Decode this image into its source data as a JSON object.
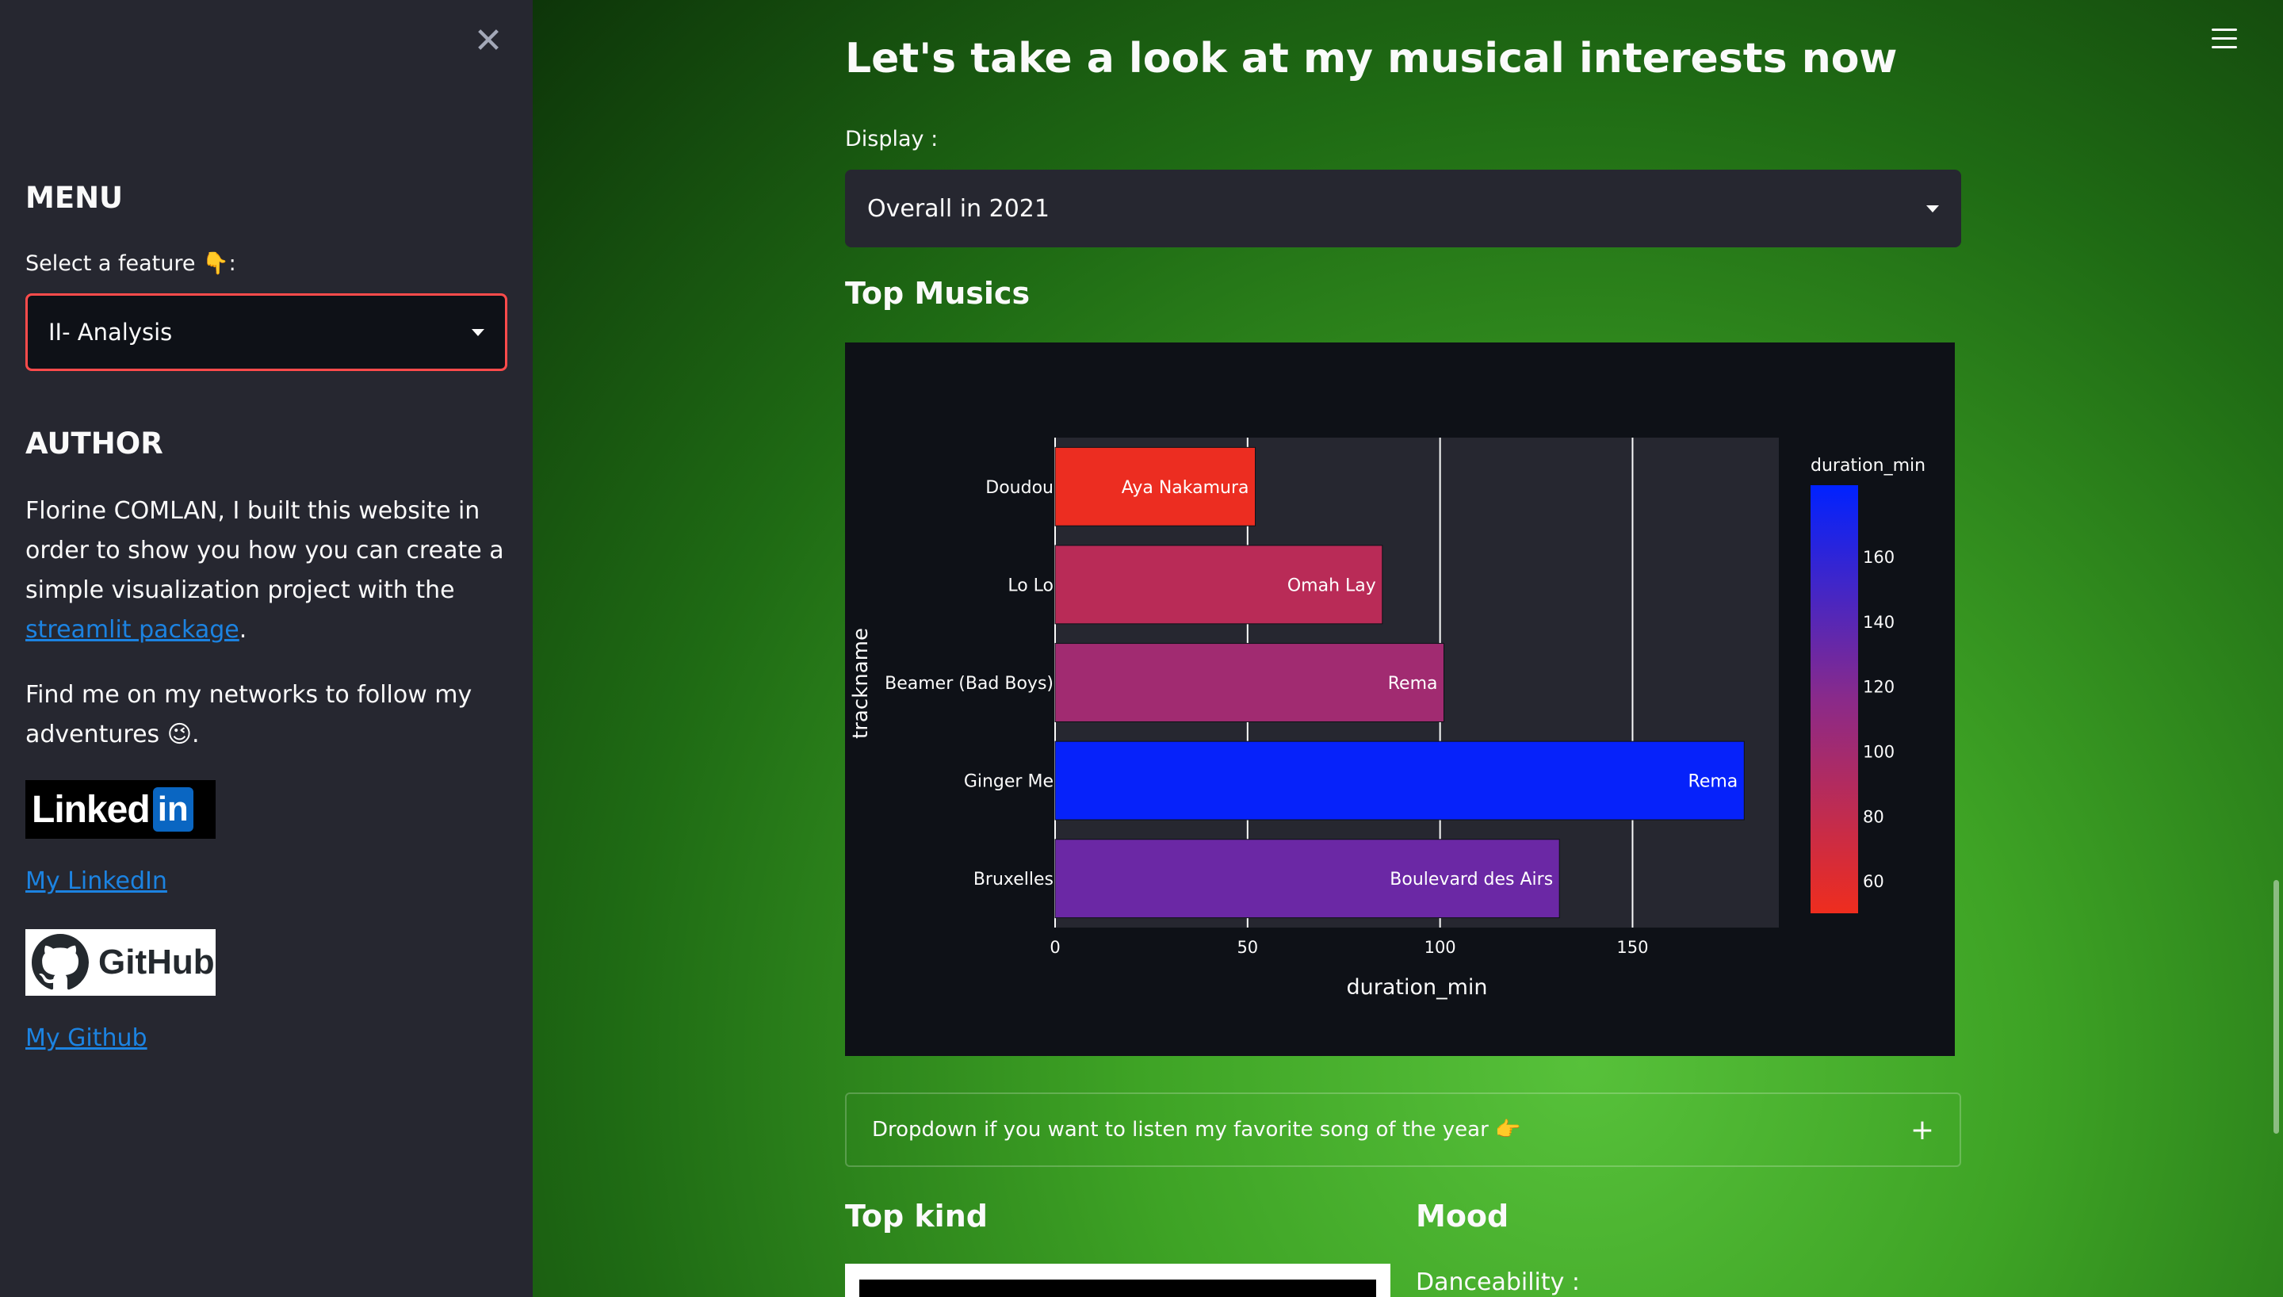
{
  "sidebar": {
    "close_symbol": "✕",
    "menu_title": "MENU",
    "select_label": "Select a feature 👇:",
    "select_value": "II- Analysis",
    "author_title": "AUTHOR",
    "author_text_pre": "Florine COMLAN, I built this website in order to show you how you can create a simple visualization project with the ",
    "author_link": "streamlit package",
    "author_text_post": ".",
    "networks_text": "Find me on my networks to follow my adventures 😉.",
    "linkedin_badge_word": "Linked",
    "linkedin_badge_in": "in",
    "linkedin_link": "My LinkedIn",
    "github_badge_text": "GitHub",
    "github_link": "My Github"
  },
  "main": {
    "title": "Let's take a look at my musical interests now",
    "display_label": "Display :",
    "display_value": "Overall in 2021",
    "top_musics_title": "Top Musics",
    "expander_text": "Dropdown if you want to listen my favorite song of the year 👉",
    "expander_symbol": "+",
    "top_kind_title": "Top kind",
    "mood_title": "Mood",
    "danceability_label": "Danceability :"
  },
  "chart_data": {
    "type": "bar",
    "orientation": "horizontal",
    "categories": [
      "Doudou",
      "Lo Lo",
      "Beamer (Bad Boys)",
      "Ginger Me",
      "Bruxelles"
    ],
    "values": [
      52,
      85,
      101,
      179,
      131
    ],
    "bar_labels": [
      "Aya Nakamura",
      "Omah Lay",
      "Rema",
      "Rema",
      "Boulevard des Airs"
    ],
    "xlabel": "duration_min",
    "ylabel": "trackname",
    "xlim": [
      0,
      188
    ],
    "xticks": [
      "0",
      "50",
      "100",
      "150"
    ],
    "colorbar": {
      "title": "duration_min",
      "range": [
        50,
        182
      ],
      "ticks": [
        "160",
        "140",
        "120",
        "100",
        "80",
        "60"
      ],
      "colors": [
        "#ef2d1e",
        "#8a2a8a",
        "#0022ff"
      ]
    },
    "background_color": "#0e1117",
    "plot_color": "#262730",
    "grid": true
  }
}
